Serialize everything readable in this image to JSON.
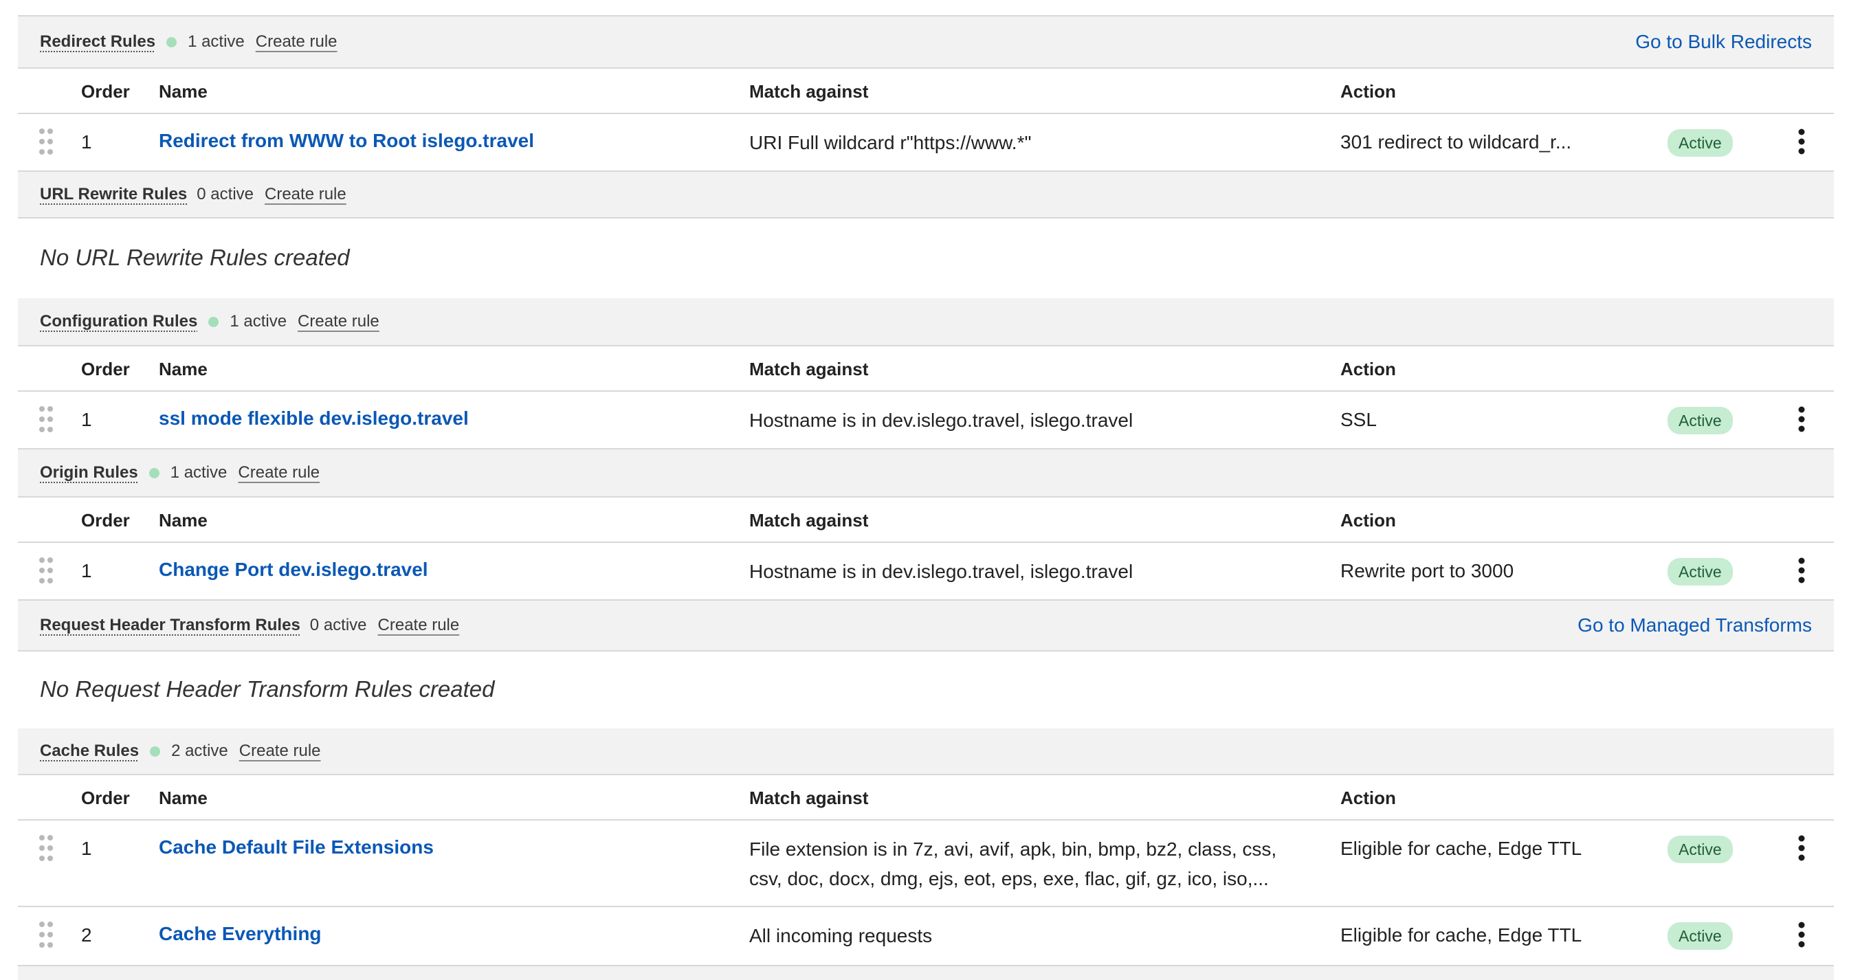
{
  "columns": {
    "order": "Order",
    "name": "Name",
    "match": "Match against",
    "action": "Action"
  },
  "sections": {
    "redirect": {
      "title": "Redirect Rules",
      "count": "1 active",
      "create": "Create rule",
      "link": "Go to Bulk Redirects",
      "rows": [
        {
          "order": "1",
          "name": "Redirect from WWW to Root islego.travel",
          "match": "URI Full wildcard r\"https://www.*\"",
          "action": "301 redirect to wildcard_r...",
          "status": "Active"
        }
      ]
    },
    "url_rewrite": {
      "title": "URL Rewrite Rules",
      "count": "0 active",
      "create": "Create rule",
      "empty": "No URL Rewrite Rules created"
    },
    "configuration": {
      "title": "Configuration Rules",
      "count": "1 active",
      "create": "Create rule",
      "rows": [
        {
          "order": "1",
          "name": "ssl mode flexible dev.islego.travel",
          "match": "Hostname is in dev.islego.travel, islego.travel",
          "action": "SSL",
          "status": "Active"
        }
      ]
    },
    "origin": {
      "title": "Origin Rules",
      "count": "1 active",
      "create": "Create rule",
      "rows": [
        {
          "order": "1",
          "name": "Change Port dev.islego.travel",
          "match": "Hostname is in dev.islego.travel, islego.travel",
          "action": "Rewrite port to 3000",
          "status": "Active"
        }
      ]
    },
    "request_header": {
      "title": "Request Header Transform Rules",
      "count": "0 active",
      "create": "Create rule",
      "link": "Go to Managed Transforms",
      "empty": "No Request Header Transform Rules created"
    },
    "cache": {
      "title": "Cache Rules",
      "count": "2 active",
      "create": "Create rule",
      "rows": [
        {
          "order": "1",
          "name": "Cache Default File Extensions",
          "match_line1": "File extension is in 7z, avi, avif, apk, bin, bmp, bz2, class, css,",
          "match_line2": "csv, doc, docx, dmg, ejs, eot, eps, exe, flac, gif, gz, ico, iso,...",
          "action": "Eligible for cache, Edge TTL",
          "status": "Active"
        },
        {
          "order": "2",
          "name": "Cache Everything",
          "match": "All incoming requests",
          "action": "Eligible for cache, Edge TTL",
          "status": "Active"
        }
      ]
    }
  },
  "icons": {
    "drag": "drag-handle-icon",
    "menu": "kebab-menu-icon"
  },
  "colors": {
    "link": "#0a58b6",
    "active_badge_bg": "#c6ecd2",
    "active_dot": "#a4dfb9",
    "header_bg": "#f2f2f2"
  }
}
